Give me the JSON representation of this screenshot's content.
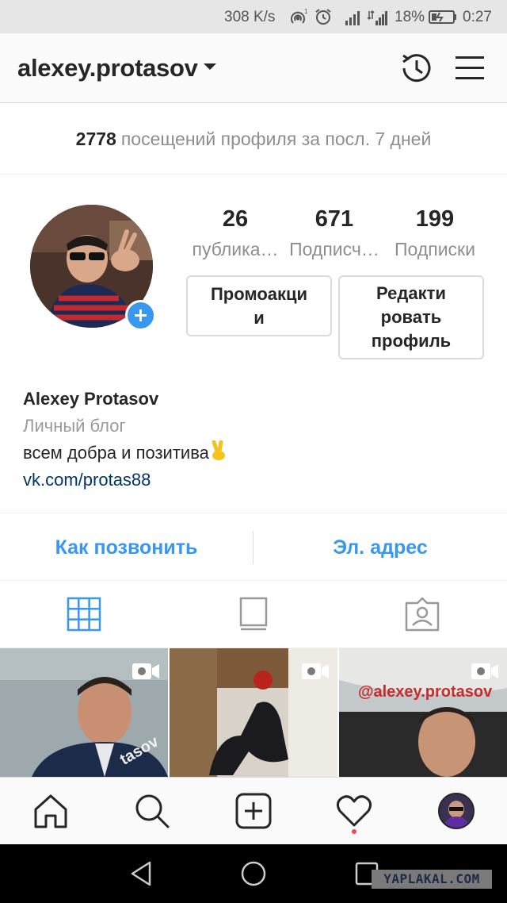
{
  "status_bar": {
    "network_rate": "308 K/s",
    "battery_percent": "18%",
    "time": "0:27"
  },
  "header": {
    "username": "alexey.protasov",
    "icons": [
      "history-icon",
      "menu-icon"
    ]
  },
  "insights": {
    "count": "2778",
    "text": "посещений профиля за посл. 7 дней"
  },
  "stats": [
    {
      "value": "26",
      "label": "публика…"
    },
    {
      "value": "671",
      "label": "Подписч…"
    },
    {
      "value": "199",
      "label": "Подписки"
    }
  ],
  "buttons": {
    "promotions_line1": "Промоакци",
    "promotions_line2": "и",
    "edit_line1": "Редакти",
    "edit_line2": "ровать",
    "edit_line3": "профиль"
  },
  "bio": {
    "full_name": "Alexey Protasov",
    "category": "Личный блог",
    "description": "всем добра и позитива",
    "link": "vk.com/protas88"
  },
  "contact": {
    "call": "Как позвонить",
    "email": "Эл. адрес"
  },
  "grid": {
    "posts": [
      {
        "overlay": "tasov",
        "type": "video"
      },
      {
        "overlay": "",
        "type": "video"
      },
      {
        "overlay": "@alexey.protasov",
        "type": "video"
      }
    ]
  },
  "colors": {
    "accent": "#3897f0",
    "link": "#003569",
    "notification": "#ed4956"
  },
  "watermark": "YAPLAKAL.COM"
}
